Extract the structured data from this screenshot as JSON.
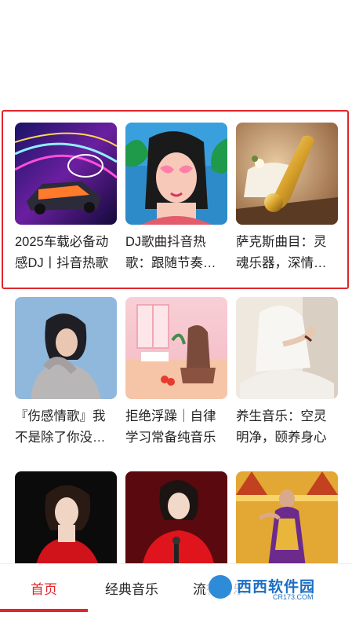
{
  "cards": [
    {
      "title": "2025车载必备动感DJ丨抖音热歌",
      "image": "neon-sports-car"
    },
    {
      "title": "DJ歌曲抖音热歌：跟随节奏摇摆",
      "image": "anime-girl-heart-glasses"
    },
    {
      "title": "萨克斯曲目：灵魂乐器，深情演绎",
      "image": "golden-saxophone"
    },
    {
      "title": "『伤感情歌』我不是除了你没人要",
      "image": "woman-portrait-blue"
    },
    {
      "title": "拒绝浮躁｜自律学习常备纯音乐",
      "image": "cozy-desk-illustration"
    },
    {
      "title": "养生音乐：空灵明净，颐养身心",
      "image": "meditation-pose"
    },
    {
      "title": "",
      "image": "woman-red-dress"
    },
    {
      "title": "",
      "image": "singer-red-suit"
    },
    {
      "title": "",
      "image": "thai-dancer"
    }
  ],
  "tabs": {
    "home": "首页",
    "classic": "经典音乐",
    "popular": "流行音乐"
  },
  "watermark": {
    "brand": "西西软件园",
    "domain": "CR173.COM"
  },
  "colors": {
    "accent": "#e0262b"
  }
}
